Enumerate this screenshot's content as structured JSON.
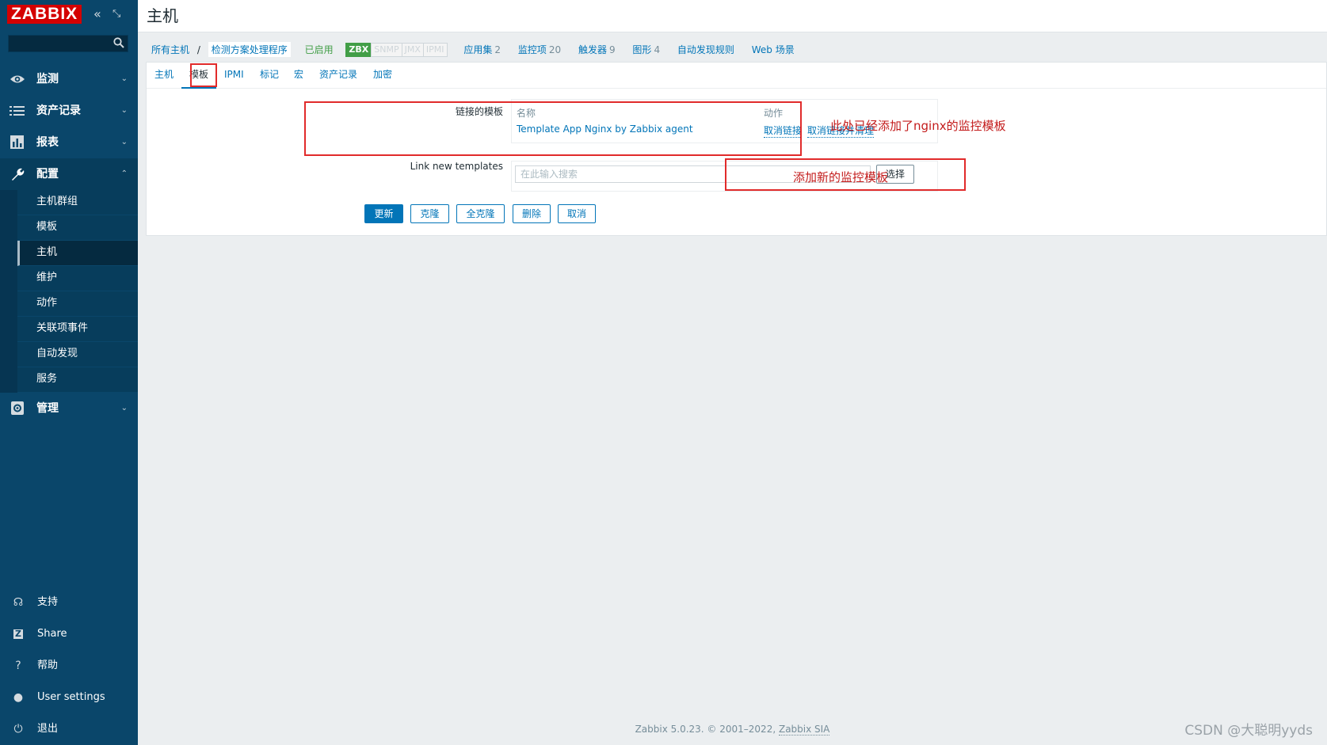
{
  "app": {
    "logo": "ZABBIX",
    "page_title": "主机"
  },
  "sidebar": {
    "search_placeholder": "",
    "menu": [
      {
        "label": "监测",
        "icon": "eye-icon"
      },
      {
        "label": "资产记录",
        "icon": "list-icon"
      },
      {
        "label": "报表",
        "icon": "bar-chart-icon"
      },
      {
        "label": "配置",
        "icon": "wrench-icon"
      },
      {
        "label": "管理",
        "icon": "gear-icon"
      }
    ],
    "config_submenu": [
      "主机群组",
      "模板",
      "主机",
      "维护",
      "动作",
      "关联项事件",
      "自动发现",
      "服务"
    ],
    "selected_submenu": "主机",
    "bottom": [
      {
        "label": "支持",
        "icon": "headset-icon"
      },
      {
        "label": "Share",
        "icon": "share-z-icon"
      },
      {
        "label": "帮助",
        "icon": "help-icon"
      },
      {
        "label": "User settings",
        "icon": "user-icon"
      },
      {
        "label": "退出",
        "icon": "power-icon"
      }
    ]
  },
  "hostnav": {
    "all_hosts": "所有主机",
    "separator": "/",
    "current_host": "检测方案处理程序",
    "status": "已启用",
    "availability": [
      "ZBX",
      "SNMP",
      "JMX",
      "IPMI"
    ],
    "links": [
      {
        "label": "应用集",
        "count": "2"
      },
      {
        "label": "监控项",
        "count": "20"
      },
      {
        "label": "触发器",
        "count": "9"
      },
      {
        "label": "图形",
        "count": "4"
      },
      {
        "label": "自动发现规则",
        "count": ""
      },
      {
        "label": "Web 场景",
        "count": ""
      }
    ]
  },
  "tabs": [
    "主机",
    "模板",
    "IPMI",
    "标记",
    "宏",
    "资产记录",
    "加密"
  ],
  "active_tab": "模板",
  "form": {
    "linked_label": "链接的模板",
    "col_name": "名称",
    "col_action": "动作",
    "linked_templates": [
      {
        "name": "Template App Nginx by Zabbix agent",
        "unlink": "取消链接",
        "unlink_clear": "取消链接并清理"
      }
    ],
    "new_label": "Link new templates",
    "search_placeholder": "在此输入搜索",
    "select_button": "选择",
    "buttons": [
      "更新",
      "克隆",
      "全克隆",
      "删除",
      "取消"
    ]
  },
  "annotations": {
    "linked_note": "此处已经添加了nginx的监控模板",
    "new_note": "添加新的监控模板"
  },
  "footer": {
    "text": "Zabbix 5.0.23. © 2001–2022, ",
    "company": "Zabbix SIA"
  },
  "watermark": "CSDN @大聪明yyds",
  "colors": {
    "sidebar": "#0a466a",
    "accent": "#0275b8",
    "logo": "#d40000",
    "annotation": "#e12b2b",
    "enabled": "#429e47"
  }
}
